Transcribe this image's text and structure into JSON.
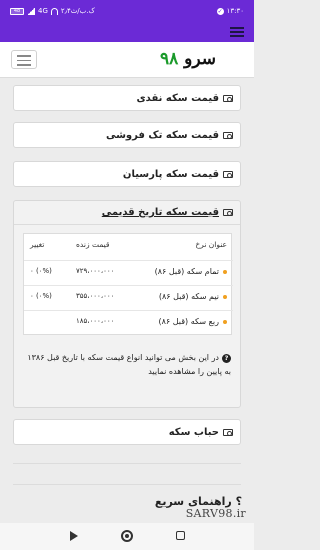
{
  "status_bar": {
    "time": "۱۳:۳۰",
    "network_speed": "۲٫۴ک.ب/ث",
    "battery": "48",
    "carrier_label": "4G",
    "icons": [
      "shield-icon",
      "wifi-icon",
      "signal-icon",
      "battery-icon"
    ]
  },
  "header": {
    "brand_text": "سرو",
    "brand_number": "۹۸"
  },
  "cards": {
    "cash_price": "قیمت سکه نقدی",
    "single_sale": "قیمت سکه تک فروشی",
    "parsian": "قیمت سکه پارسیان",
    "old_history": "قیمت سکه تاریخ قدیمی",
    "bubble": "حباب سکه"
  },
  "history_table": {
    "columns": {
      "name": "عنوان نرخ",
      "price": "قیمت زنده",
      "change": "تغییر"
    },
    "rows": [
      {
        "name": "تمام سکه (قبل ۸۶)",
        "price": "۷۲۹،۰۰۰،۰۰۰",
        "change": "۰ (۰%)"
      },
      {
        "name": "نیم سکه (قبل ۸۶)",
        "price": "۳۵۵،۰۰۰،۰۰۰",
        "change": "۰ (۰%)"
      },
      {
        "name": "ربع سکه (قبل ۸۶)",
        "price": "۱۸۵،۰۰۰،۰۰۰",
        "change": ""
      }
    ]
  },
  "note_text": "در این بخش می توانید انواع قیمت سکه با تاریخ قبل ۱۳۸۶ به پایین را مشاهده نمایید",
  "quick_guide": "راهنمای سریع",
  "watermark": "SARV98.ir",
  "colors": {
    "accent": "#6b2ad6",
    "brand_green": "#1a9a2a",
    "bullet_orange": "#f0a020"
  }
}
